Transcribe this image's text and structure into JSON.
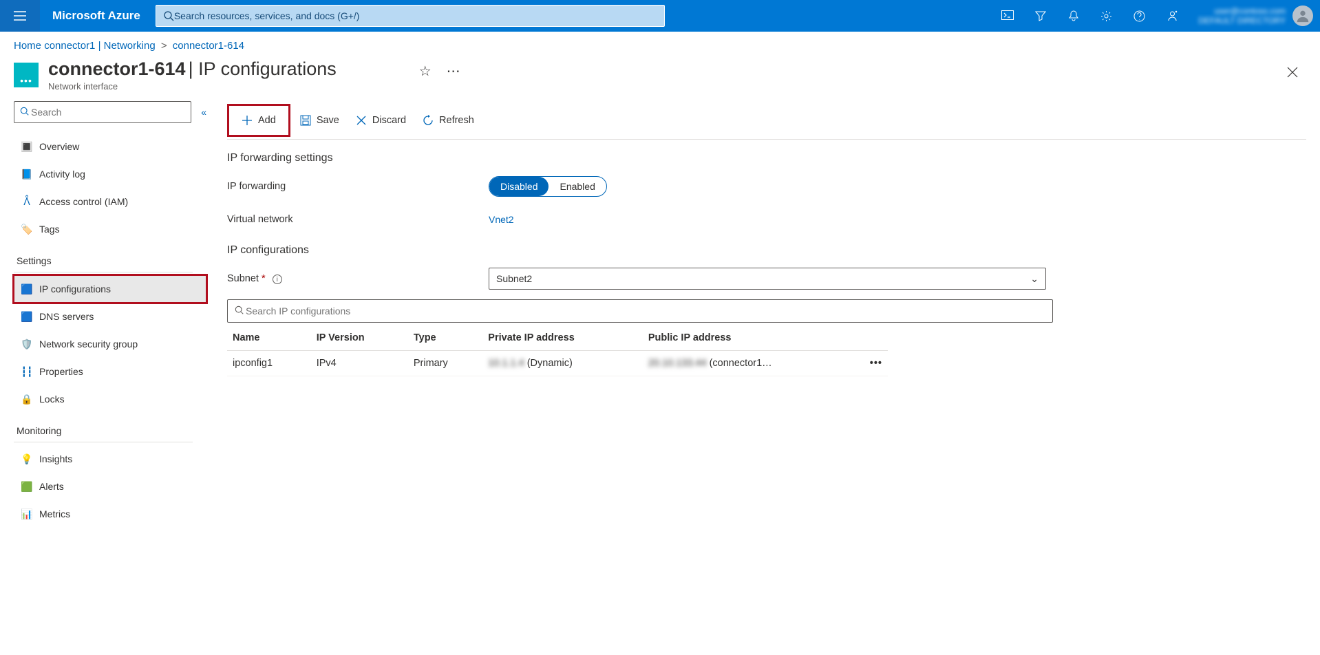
{
  "topbar": {
    "brand": "Microsoft Azure",
    "search_placeholder": "Search resources, services, and docs (G+/)",
    "account_line1": "user@contoso.com",
    "account_line2": "DEFAULT DIRECTORY"
  },
  "breadcrumbs": {
    "c1": "Home",
    "c2": "connector1 | Networking",
    "c3": "connector1-614"
  },
  "header": {
    "title_main": "connector1-614",
    "title_sub": " | IP configurations",
    "subtype": "Network interface"
  },
  "sidebar": {
    "search_placeholder": "Search",
    "items_top": {
      "overview": "Overview",
      "activity": "Activity log",
      "iam": "Access control (IAM)",
      "tags": "Tags"
    },
    "group_settings": "Settings",
    "items_settings": {
      "ipconfig": "IP configurations",
      "dns": "DNS servers",
      "nsg": "Network security group",
      "props": "Properties",
      "locks": "Locks"
    },
    "group_monitor": "Monitoring",
    "items_monitor": {
      "insights": "Insights",
      "alerts": "Alerts",
      "metrics": "Metrics"
    }
  },
  "commands": {
    "add": "Add",
    "save": "Save",
    "discard": "Discard",
    "refresh": "Refresh"
  },
  "sections": {
    "fwd_title": "IP forwarding settings",
    "fwd_label": "IP forwarding",
    "toggle_disabled": "Disabled",
    "toggle_enabled": "Enabled",
    "vnet_label": "Virtual network",
    "vnet_value": "Vnet2",
    "ipcfg_title": "IP configurations",
    "subnet_label": "Subnet",
    "subnet_value": "Subnet2",
    "ipsearch_placeholder": "Search IP configurations"
  },
  "table": {
    "cols": {
      "name": "Name",
      "ver": "IP Version",
      "type": "Type",
      "priv": "Private IP address",
      "pub": "Public IP address"
    },
    "rows": [
      {
        "name": "ipconfig1",
        "ver": "IPv4",
        "type": "Primary",
        "priv_blur": "10.1.1.4",
        "priv_suffix": " (Dynamic)",
        "pub_blur": "20.10.133.44",
        "pub_suffix": " (connector1…"
      }
    ]
  }
}
